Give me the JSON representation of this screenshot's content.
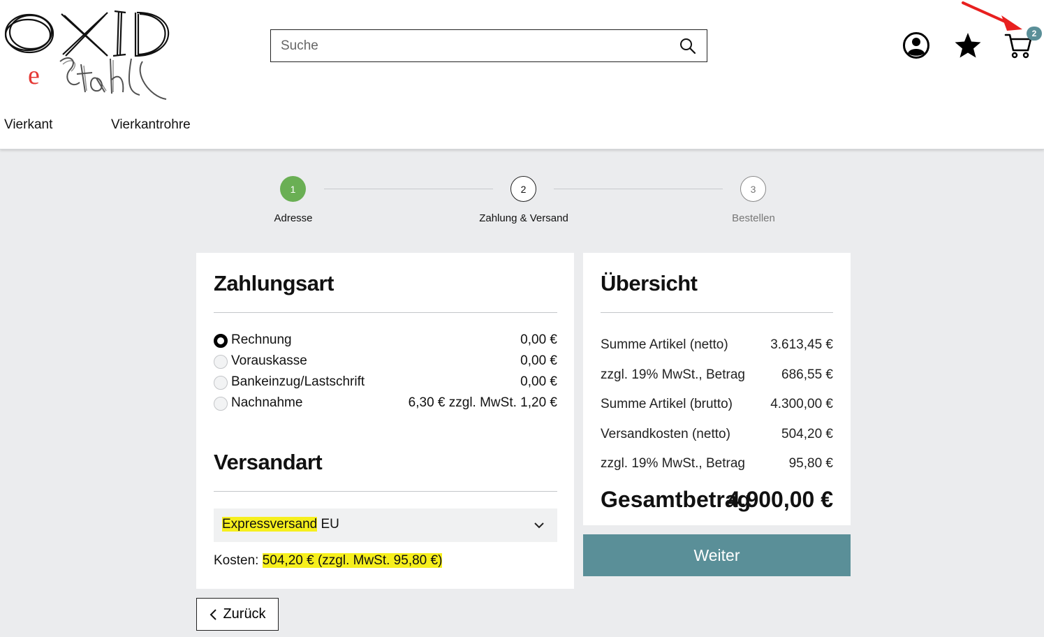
{
  "header": {
    "logo_text_main": "OXID",
    "logo_text_sub": "eStahl",
    "search_placeholder": "Suche",
    "cart_count": "2",
    "nav": [
      "Vierkant",
      "Vierkantrohre"
    ]
  },
  "steps": [
    {
      "number": "1",
      "label": "Adresse",
      "state": "done"
    },
    {
      "number": "2",
      "label": "Zahlung & Versand",
      "state": "active"
    },
    {
      "number": "3",
      "label": "Bestellen",
      "state": "upcoming"
    }
  ],
  "payment": {
    "title": "Zahlungsart",
    "options": [
      {
        "label": "Rechnung",
        "price": "0,00 €",
        "checked": true
      },
      {
        "label": "Vorauskasse",
        "price": "0,00 €",
        "checked": false
      },
      {
        "label": "Bankeinzug/Lastschrift",
        "price": "0,00 €",
        "checked": false
      },
      {
        "label": "Nachnahme",
        "price": "6,30 € zzgl. MwSt. 1,20 €",
        "checked": false
      }
    ]
  },
  "shipping": {
    "title": "Versandart",
    "selected_highlight": "Expressversand",
    "selected_rest": " EU",
    "cost_label": "Kosten: ",
    "cost_value": "504,20 € (zzgl. MwSt. 95,80 €)"
  },
  "summary": {
    "title": "Übersicht",
    "rows": [
      {
        "label": "Summe Artikel (netto)",
        "value": "3.613,45 €"
      },
      {
        "label": "zzgl. 19% MwSt., Betrag",
        "value": "686,55 €"
      },
      {
        "label": "Summe Artikel (brutto)",
        "value": "4.300,00 €"
      },
      {
        "label": "Versandkosten (netto)",
        "value": "504,20 €"
      },
      {
        "label": "zzgl. 19% MwSt., Betrag",
        "value": "95,80 €"
      }
    ],
    "total_label": "Gesamtbetrag",
    "total_value": "4.900,00 €"
  },
  "buttons": {
    "next": "Weiter",
    "back": "Zurück"
  },
  "colors": {
    "accent": "#5a8f98",
    "step_done": "#6aaf54",
    "highlight": "#f6ef1d",
    "arrow": "#e8201f"
  }
}
